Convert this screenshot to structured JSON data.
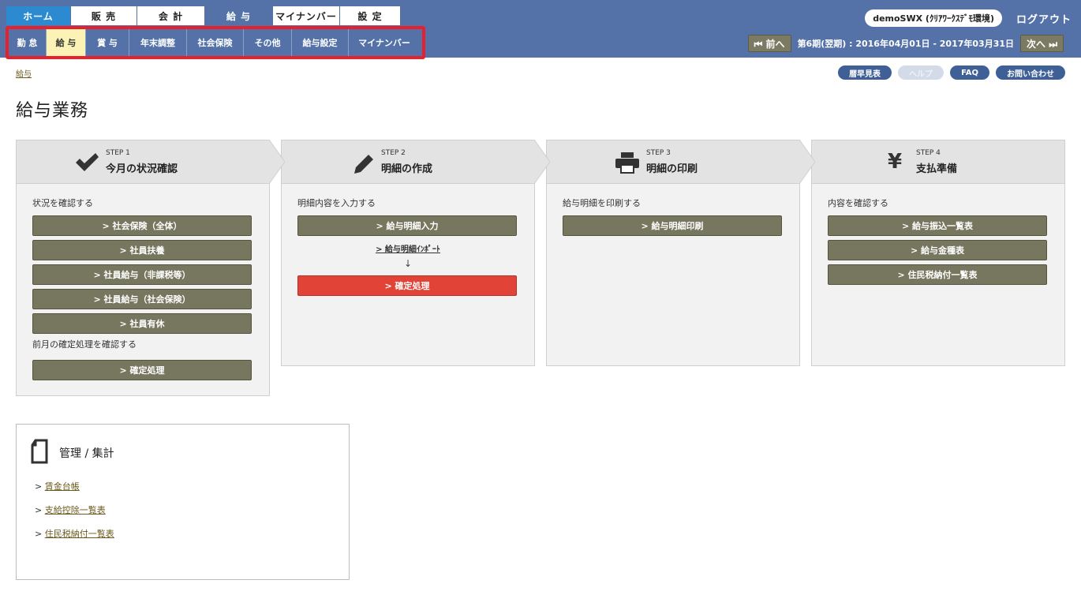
{
  "header": {
    "main_tabs": [
      {
        "label": "ホーム",
        "state": "home"
      },
      {
        "label": "販 売",
        "state": "normal"
      },
      {
        "label": "会 計",
        "state": "normal"
      },
      {
        "label": "給 与",
        "state": "active"
      },
      {
        "label": "マイナンバー",
        "state": "normal"
      },
      {
        "label": "設 定",
        "state": "normal"
      }
    ],
    "user_badge": "demoSWX (ｸﾘｱﾜｰｸｽﾃﾞﾓ環境)",
    "logout": "ログアウト",
    "sub_tabs": [
      {
        "label": "勤 怠",
        "active": false
      },
      {
        "label": "給 与",
        "active": true
      },
      {
        "label": "賞 与",
        "active": false
      },
      {
        "label": "年末調整",
        "active": false
      },
      {
        "label": "社会保険",
        "active": false
      },
      {
        "label": "その他",
        "active": false
      },
      {
        "label": "給与設定",
        "active": false
      },
      {
        "label": "マイナンバー",
        "active": false
      }
    ],
    "period": {
      "prev": "⏮ 前へ",
      "text": "第6期(翌期) : 2016年04月01日 - 2017年03月31日",
      "next": "次へ ⏭"
    }
  },
  "breadcrumb": "給与",
  "help_pills": [
    {
      "label": "暦早見表",
      "disabled": false
    },
    {
      "label": "ヘルプ",
      "disabled": true
    },
    {
      "label": "FAQ",
      "disabled": false
    },
    {
      "label": "お問い合わせ",
      "disabled": false
    }
  ],
  "page_title": "給与業務",
  "steps": [
    {
      "step_no": "STEP 1",
      "title": "今月の状況確認",
      "icon": "check-icon",
      "desc": "状況を確認する",
      "buttons": [
        "> 社会保険（全体）",
        "> 社員扶養",
        "> 社員給与（非課税等）",
        "> 社員給与（社会保険）",
        "> 社員有休"
      ],
      "desc2": "前月の確定処理を確認する",
      "buttons2": [
        "> 確定処理"
      ]
    },
    {
      "step_no": "STEP 2",
      "title": "明細の作成",
      "icon": "pencil-icon",
      "desc": "明細内容を入力する",
      "buttons": [
        "> 給与明細入力"
      ],
      "link": "> 給与明細ｲﾝﾎﾟｰﾄ",
      "arrow": "↓",
      "red_button": "> 確定処理"
    },
    {
      "step_no": "STEP 3",
      "title": "明細の印刷",
      "icon": "printer-icon",
      "desc": "給与明細を印刷する",
      "buttons": [
        "> 給与明細印刷"
      ]
    },
    {
      "step_no": "STEP 4",
      "title": "支払準備",
      "icon": "yen-icon",
      "icon_glyph": "¥",
      "desc": "内容を確認する",
      "buttons": [
        "> 給与振込一覧表",
        "> 給与金種表",
        "> 住民税納付一覧表"
      ]
    }
  ],
  "admin": {
    "title": "管理 / 集計",
    "links": [
      "賃金台帳",
      "支給控除一覧表",
      "住民税納付一覧表"
    ],
    "prefix": ">"
  }
}
